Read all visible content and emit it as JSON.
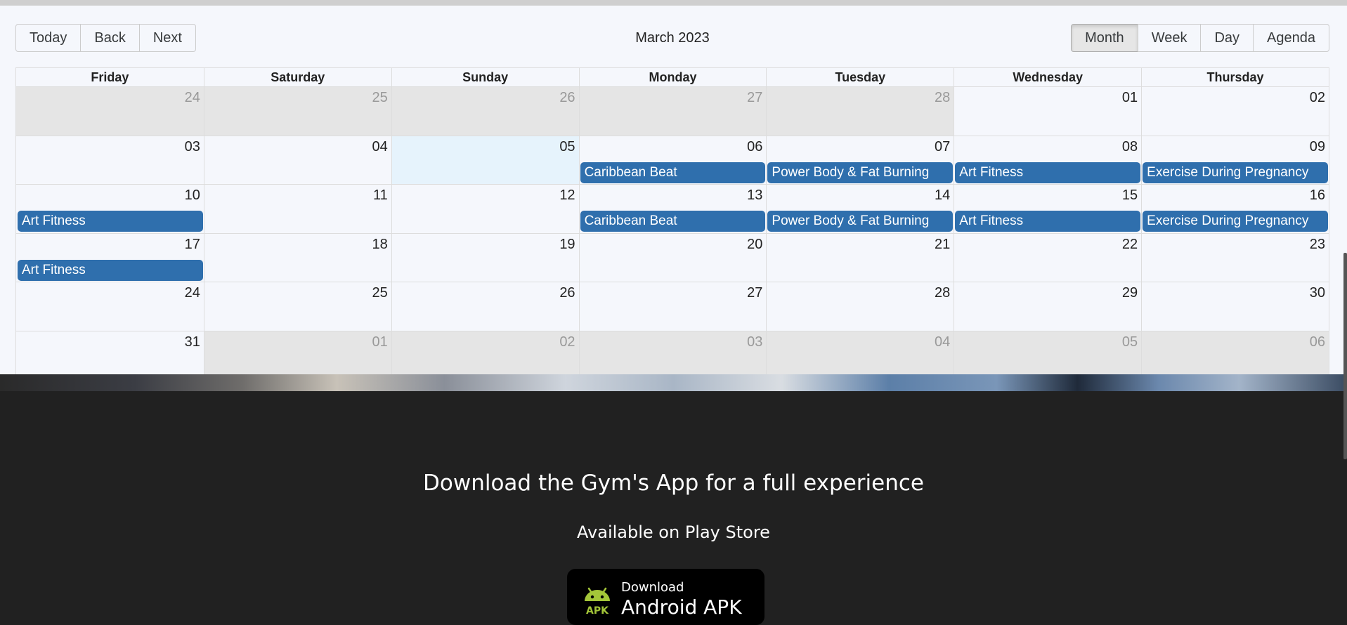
{
  "toolbar": {
    "nav_buttons": [
      "Today",
      "Back",
      "Next"
    ],
    "label": "March 2023",
    "view_buttons": [
      "Month",
      "Week",
      "Day",
      "Agenda"
    ],
    "active_view": "Month"
  },
  "calendar": {
    "weekdays": [
      "Friday",
      "Saturday",
      "Sunday",
      "Monday",
      "Tuesday",
      "Wednesday",
      "Thursday"
    ],
    "weeks": [
      {
        "dates": [
          "24",
          "25",
          "26",
          "27",
          "28",
          "01",
          "02"
        ],
        "off": [
          true,
          true,
          true,
          true,
          true,
          false,
          false
        ],
        "events": [
          "",
          "",
          "",
          "",
          "",
          "",
          ""
        ]
      },
      {
        "dates": [
          "03",
          "04",
          "05",
          "06",
          "07",
          "08",
          "09"
        ],
        "off": [
          false,
          false,
          false,
          false,
          false,
          false,
          false
        ],
        "today_index": 2,
        "events": [
          "",
          "",
          "",
          "Caribbean Beat",
          "Power Body & Fat Burning",
          "Art Fitness",
          "Exercise During Pregnancy"
        ]
      },
      {
        "dates": [
          "10",
          "11",
          "12",
          "13",
          "14",
          "15",
          "16"
        ],
        "off": [
          false,
          false,
          false,
          false,
          false,
          false,
          false
        ],
        "events": [
          "Art Fitness",
          "",
          "",
          "Caribbean Beat",
          "Power Body & Fat Burning",
          "Art Fitness",
          "Exercise During Pregnancy"
        ]
      },
      {
        "dates": [
          "17",
          "18",
          "19",
          "20",
          "21",
          "22",
          "23"
        ],
        "off": [
          false,
          false,
          false,
          false,
          false,
          false,
          false
        ],
        "events": [
          "Art Fitness",
          "",
          "",
          "",
          "",
          "",
          ""
        ]
      },
      {
        "dates": [
          "24",
          "25",
          "26",
          "27",
          "28",
          "29",
          "30"
        ],
        "off": [
          false,
          false,
          false,
          false,
          false,
          false,
          false
        ],
        "events": [
          "",
          "",
          "",
          "",
          "",
          "",
          ""
        ]
      },
      {
        "dates": [
          "31",
          "01",
          "02",
          "03",
          "04",
          "05",
          "06"
        ],
        "off": [
          false,
          true,
          true,
          true,
          true,
          true,
          true
        ],
        "events": [
          "",
          "",
          "",
          "",
          "",
          "",
          ""
        ]
      }
    ],
    "event_color": "#2f6fad"
  },
  "footer": {
    "heading": "Download the Gym's App for a full experience",
    "subheading": "Available on Play Store",
    "apk_button": {
      "line1": "Download",
      "line2": "Android APK",
      "badge": "APK",
      "icon": "android-icon"
    }
  }
}
